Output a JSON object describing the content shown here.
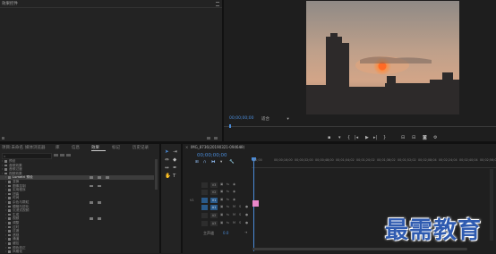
{
  "source_monitor": {
    "title": "效果控件",
    "menu_icon": "menu-icon"
  },
  "program_monitor": {
    "timecode": "00;00;00;00",
    "fit_label": "适合",
    "buttons": [
      "mark-in-icon",
      "mark-out-icon",
      "go-to-in-icon",
      "step-back-icon",
      "play-icon",
      "step-forward-icon",
      "go-to-out-icon",
      "lift-icon",
      "extract-icon",
      "export-frame-icon",
      "settings-icon"
    ]
  },
  "bottom_left": {
    "tabs": [
      "项目:未命名",
      "媒体浏览器",
      "库",
      "信息",
      "效果",
      "标记",
      "历史记录"
    ],
    "active_tab": "效果",
    "tree": [
      {
        "label": "预设",
        "indent": 0
      },
      {
        "label": "音频效果",
        "indent": 0
      },
      {
        "label": "音频过渡",
        "indent": 0
      },
      {
        "label": "视频效果",
        "indent": 0
      },
      {
        "label": "Lumetri 预设",
        "indent": 1,
        "selected": true
      },
      {
        "label": "变换",
        "indent": 1
      },
      {
        "label": "图像控制",
        "indent": 1
      },
      {
        "label": "实用程序",
        "indent": 1
      },
      {
        "label": "扭曲",
        "indent": 1
      },
      {
        "label": "时间",
        "indent": 1
      },
      {
        "label": "杂色与颗粒",
        "indent": 1
      },
      {
        "label": "模糊与锐化",
        "indent": 1
      },
      {
        "label": "沉浸式视频",
        "indent": 1
      },
      {
        "label": "生成",
        "indent": 1
      },
      {
        "label": "视频",
        "indent": 1
      },
      {
        "label": "调整",
        "indent": 1
      },
      {
        "label": "过时",
        "indent": 1
      },
      {
        "label": "过渡",
        "indent": 1
      },
      {
        "label": "透视",
        "indent": 1
      },
      {
        "label": "通道",
        "indent": 1
      },
      {
        "label": "键控",
        "indent": 1
      },
      {
        "label": "颜色校正",
        "indent": 1
      },
      {
        "label": "风格化",
        "indent": 1
      }
    ]
  },
  "timeline": {
    "tab_title": "IMG_8736(20190321-094649)",
    "timecode": "00;00;00;00",
    "ruler": [
      "00;00",
      "00;00;16;00",
      "00;00;32;00",
      "00;00;48;00",
      "00;01;04;02",
      "00;01;20;02",
      "00;01;36;02",
      "00;01;52;02",
      "00;02;08;04",
      "00;02;24;04",
      "00;02;40;04",
      "00;02;56;04"
    ],
    "video_tracks": [
      "V3",
      "V2",
      "V1"
    ],
    "audio_tracks": [
      "A1",
      "A2",
      "A3"
    ],
    "master_label": "主声道",
    "master_value": "0.0"
  },
  "watermark": {
    "text": "最需教育"
  },
  "colors": {
    "accent": "#2d8ceb",
    "clip": "#e986c9"
  }
}
